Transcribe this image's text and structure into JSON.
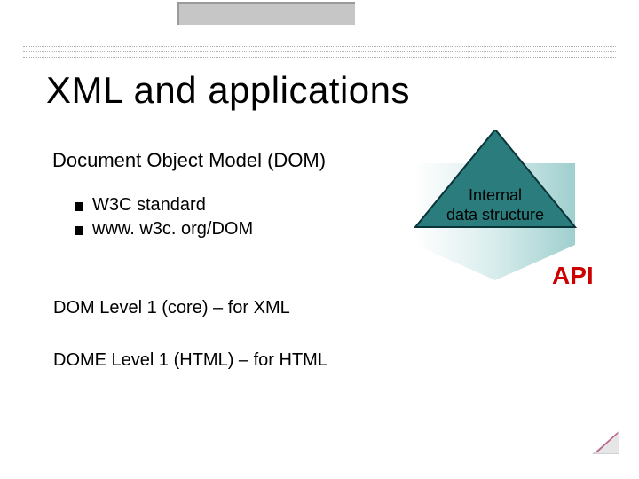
{
  "title": "XML and applications",
  "subtitle": "Document Object Model (DOM)",
  "bullets": [
    "W3C standard",
    "www. w3c. org/DOM"
  ],
  "body_lines": [
    "DOM Level 1 (core) – for XML",
    "DOME Level 1 (HTML) – for HTML"
  ],
  "diagram": {
    "top_label_line1": "Internal",
    "top_label_line2": "data structure",
    "api_label": "API"
  },
  "colors": {
    "teal": "#2b7d7d",
    "light_teal": "#bfe0df",
    "red": "#cc0000",
    "line": "#000000"
  }
}
